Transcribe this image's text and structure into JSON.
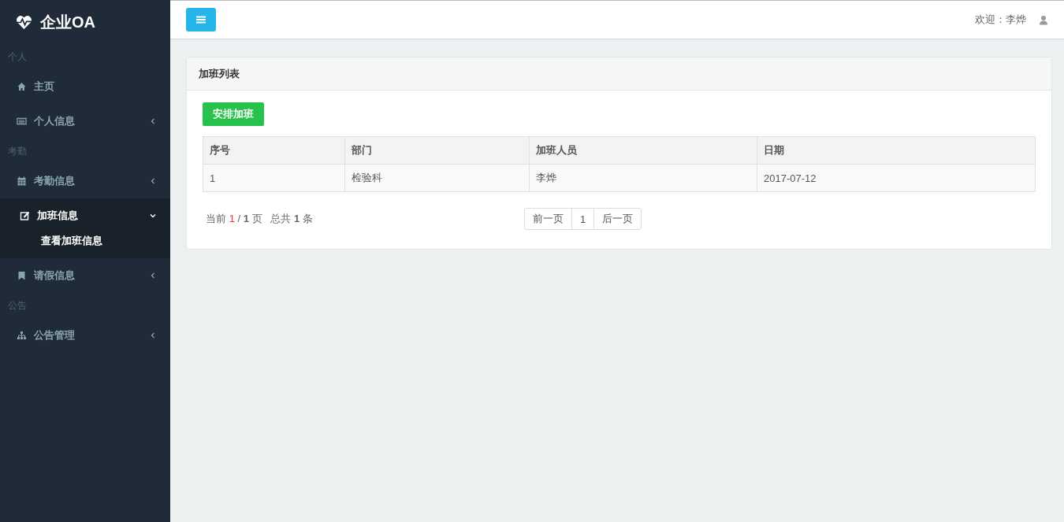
{
  "brand": {
    "title": "企业OA"
  },
  "sidebar": {
    "sections": [
      {
        "header": "个人",
        "items": [
          {
            "kind": "home",
            "label": "主页",
            "selected": false
          },
          {
            "kind": "card",
            "label": "个人信息",
            "expanded": false,
            "selected": false
          }
        ]
      },
      {
        "header": "考勤",
        "items": [
          {
            "kind": "calendar",
            "label": "考勤信息",
            "expanded": false,
            "selected": false
          },
          {
            "kind": "edit",
            "label": "加班信息",
            "expanded": true,
            "selected": true,
            "children": [
              {
                "label": "查看加班信息"
              }
            ]
          },
          {
            "kind": "bookmark",
            "label": "请假信息",
            "expanded": false,
            "selected": false
          }
        ]
      },
      {
        "header": "公告",
        "items": [
          {
            "kind": "sitemap",
            "label": "公告管理",
            "expanded": false,
            "selected": false
          }
        ]
      }
    ]
  },
  "topbar": {
    "welcome": "欢迎：李烨"
  },
  "panel": {
    "title": "加班列表",
    "add_button": "安排加班",
    "table": {
      "columns": [
        "序号",
        "部门",
        "加班人员",
        "日期"
      ],
      "rows": [
        [
          "1",
          "检验科",
          "李烨",
          "2017-07-12"
        ]
      ]
    },
    "pager_info": {
      "current_label": "当前",
      "current": "1",
      "sep": "/",
      "total": "1",
      "page_unit": "页",
      "count_label": "总共",
      "count": "1",
      "count_unit": "条"
    },
    "pager_buttons": [
      {
        "label": "前一页"
      },
      {
        "label": "1"
      },
      {
        "label": "后一页"
      }
    ]
  }
}
